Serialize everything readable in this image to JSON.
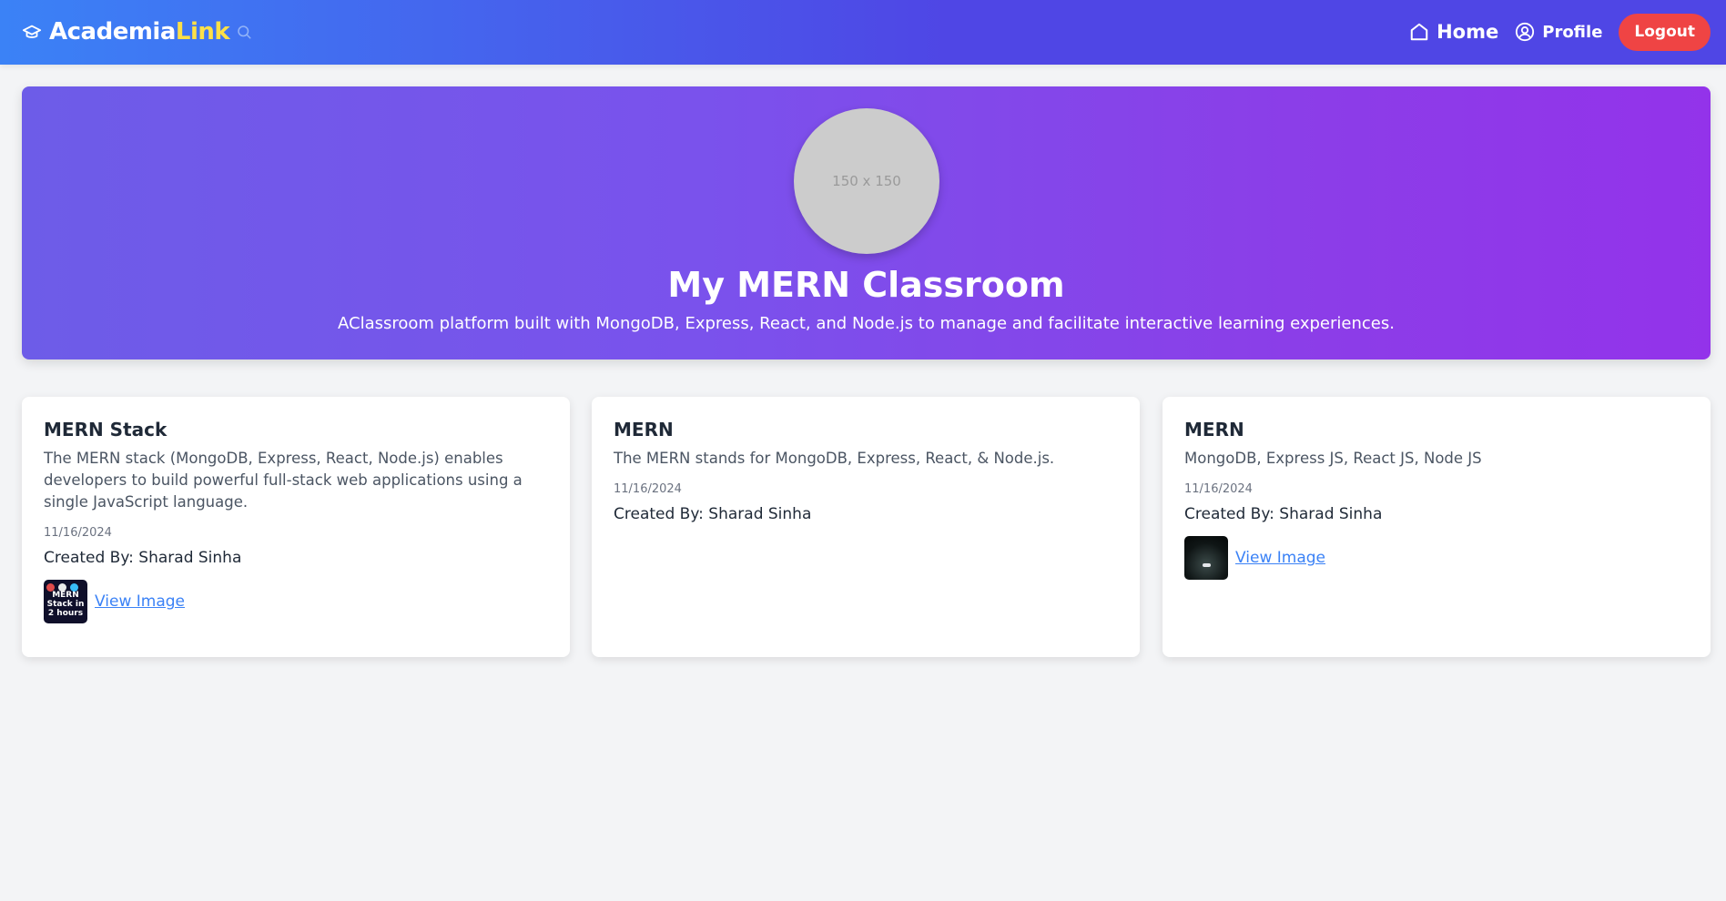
{
  "navbar": {
    "brand_part1": "Academia",
    "brand_part2": "Link",
    "home_label": "Home",
    "profile_label": "Profile",
    "logout_label": "Logout"
  },
  "hero": {
    "avatar_text": "150 x 150",
    "title": "My MERN Classroom",
    "description": "AClassroom platform built with MongoDB, Express, React, and Node.js to manage and facilitate interactive learning experiences."
  },
  "cards": [
    {
      "title": "MERN Stack",
      "description": "The MERN stack (MongoDB, Express, React, Node.js) enables developers to build powerful full-stack web applications using a single JavaScript language.",
      "date": "11/16/2024",
      "creator": "Created By: Sharad Sinha",
      "thumb_text": "MERN Stack in 2 hours",
      "link_label": "View Image"
    },
    {
      "title": "MERN",
      "description": "The MERN stands for MongoDB, Express, React, & Node.js.",
      "date": "11/16/2024",
      "creator": "Created By: Sharad Sinha"
    },
    {
      "title": "MERN",
      "description": "MongoDB, Express JS, React JS, Node JS",
      "date": "11/16/2024",
      "creator": "Created By: Sharad Sinha",
      "link_label": "View Image"
    }
  ],
  "colors": {
    "nav_start": "#3b82f6",
    "nav_end": "#4f46e5",
    "brand_accent": "#fde047",
    "logout": "#ef4444",
    "hero_start": "#6d5ce8",
    "hero_end": "#9333ea",
    "link": "#3b82f6"
  },
  "icons": [
    "graduation-cap-icon",
    "search-icon",
    "home-icon",
    "user-circle-icon"
  ]
}
